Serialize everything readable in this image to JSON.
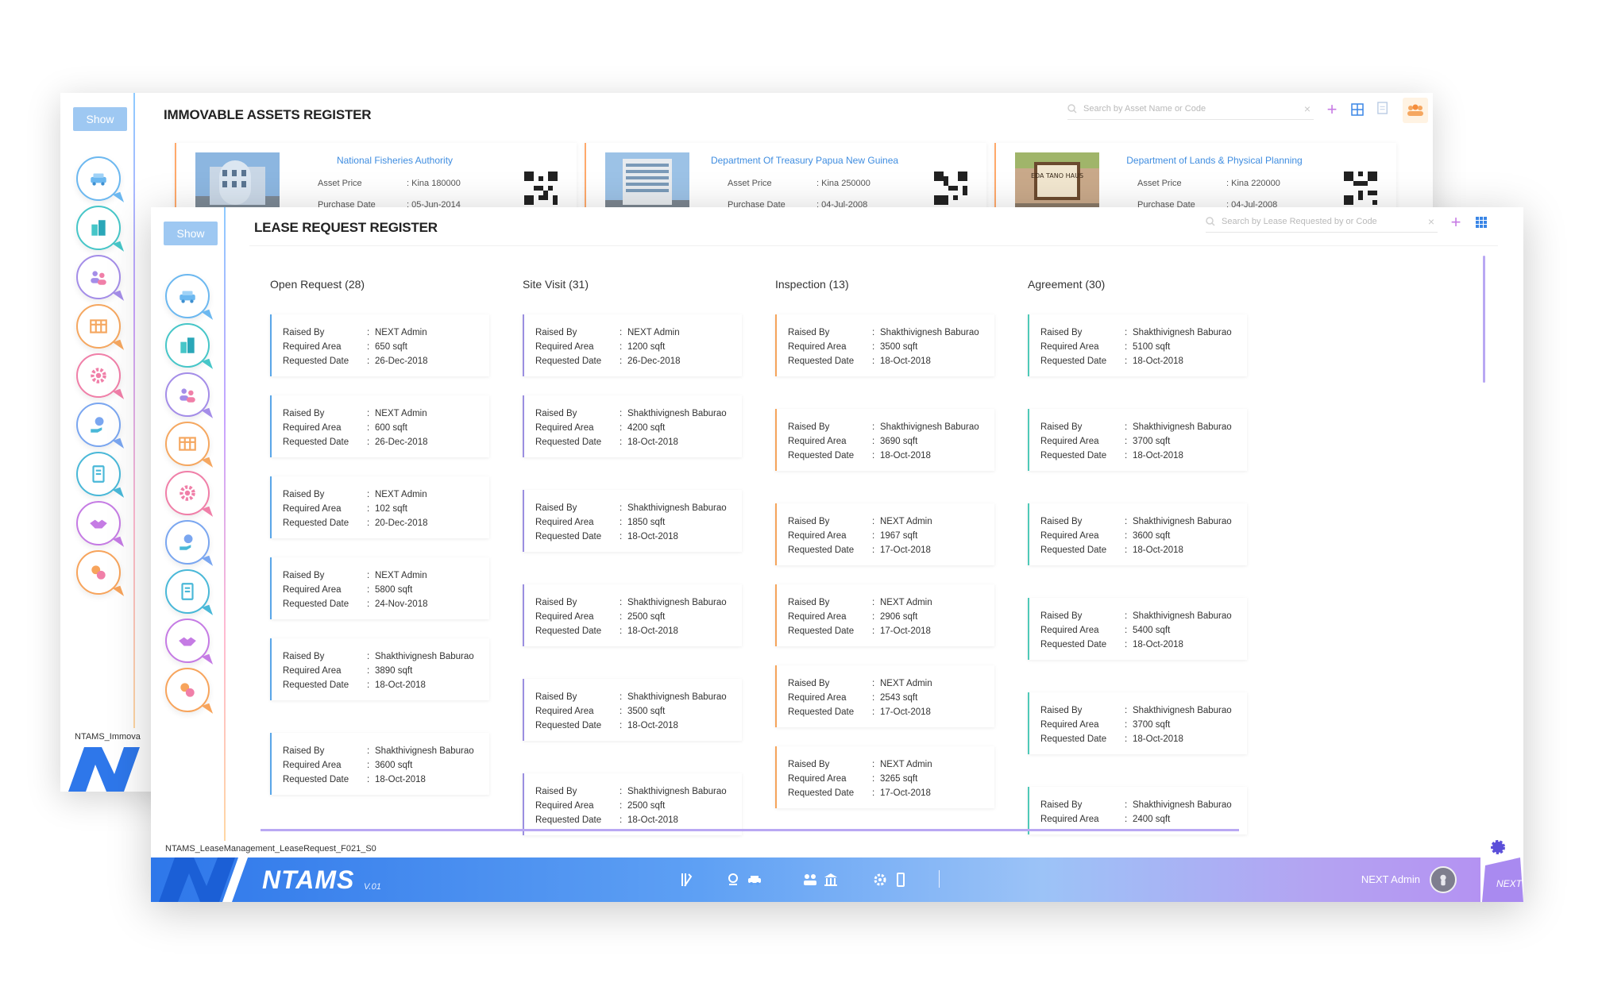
{
  "back_window": {
    "show_label": "Show",
    "title": "IMMOVABLE ASSETS REGISTER",
    "search_placeholder": "Search by Asset Name or Code",
    "footer_code": "NTAMS_Immova",
    "assets": [
      {
        "name": "National Fisheries Authority",
        "price_label": "Asset Price",
        "price": "Kina 180000",
        "date_label": "Purchase Date",
        "date": "05-Jun-2014"
      },
      {
        "name": "Department Of Treasury Papua New Guinea",
        "price_label": "Asset Price",
        "price": "Kina 250000",
        "date_label": "Purchase Date",
        "date": "04-Jul-2008"
      },
      {
        "name": "Department of Lands & Physical Planning",
        "price_label": "Asset Price",
        "price": "Kina 220000",
        "date_label": "Purchase Date",
        "date": "04-Jul-2008",
        "sign_text": "EDA TANO HAUS"
      }
    ]
  },
  "front_window": {
    "show_label": "Show",
    "title": "LEASE REQUEST REGISTER",
    "search_placeholder": "Search by Lease Requested by or Code",
    "footer_code": "NTAMS_LeaseManagement_LeaseRequest_F021_S0",
    "labels": {
      "raised_by": "Raised By",
      "required_area": "Required Area",
      "requested_date": "Requested Date",
      "colon": ":"
    },
    "columns": [
      {
        "title": "Open Request (28)",
        "color": "#5aa6e8",
        "cards": [
          {
            "raised_by": "NEXT Admin",
            "area": "650 sqft",
            "date": "26-Dec-2018"
          },
          {
            "raised_by": "NEXT Admin",
            "area": "600 sqft",
            "date": "26-Dec-2018"
          },
          {
            "raised_by": "NEXT Admin",
            "area": "102 sqft",
            "date": "20-Dec-2018"
          },
          {
            "raised_by": "NEXT Admin",
            "area": "5800 sqft",
            "date": "24-Nov-2018"
          },
          {
            "raised_by": "Shakthivignesh Baburao",
            "area": "3890 sqft",
            "date": "18-Oct-2018"
          },
          {
            "raised_by": "Shakthivignesh Baburao",
            "area": "3600 sqft",
            "date": "18-Oct-2018"
          }
        ]
      },
      {
        "title": "Site Visit (31)",
        "color": "#9b8fe0",
        "cards": [
          {
            "raised_by": "NEXT Admin",
            "area": "1200 sqft",
            "date": "26-Dec-2018"
          },
          {
            "raised_by": "Shakthivignesh Baburao",
            "area": "4200 sqft",
            "date": "18-Oct-2018"
          },
          {
            "raised_by": "Shakthivignesh Baburao",
            "area": "1850 sqft",
            "date": "18-Oct-2018"
          },
          {
            "raised_by": "Shakthivignesh Baburao",
            "area": "2500 sqft",
            "date": "18-Oct-2018"
          },
          {
            "raised_by": "Shakthivignesh Baburao",
            "area": "3500 sqft",
            "date": "18-Oct-2018"
          },
          {
            "raised_by": "Shakthivignesh Baburao",
            "area": "2500 sqft",
            "date": "18-Oct-2018"
          }
        ]
      },
      {
        "title": "Inspection (13)",
        "color": "#f5a45b",
        "cards": [
          {
            "raised_by": "Shakthivignesh Baburao",
            "area": "3500 sqft",
            "date": "18-Oct-2018"
          },
          {
            "raised_by": "Shakthivignesh Baburao",
            "area": "3690 sqft",
            "date": "18-Oct-2018"
          },
          {
            "raised_by": "NEXT Admin",
            "area": "1967 sqft",
            "date": "17-Oct-2018"
          },
          {
            "raised_by": "NEXT Admin",
            "area": "2906 sqft",
            "date": "17-Oct-2018"
          },
          {
            "raised_by": "NEXT Admin",
            "area": "2543 sqft",
            "date": "17-Oct-2018"
          },
          {
            "raised_by": "NEXT Admin",
            "area": "3265 sqft",
            "date": "17-Oct-2018"
          }
        ]
      },
      {
        "title": "Agreement (30)",
        "color": "#4fc9b8",
        "cards": [
          {
            "raised_by": "Shakthivignesh Baburao",
            "area": "5100 sqft",
            "date": "18-Oct-2018"
          },
          {
            "raised_by": "Shakthivignesh Baburao",
            "area": "3700 sqft",
            "date": "18-Oct-2018"
          },
          {
            "raised_by": "Shakthivignesh Baburao",
            "area": "3600 sqft",
            "date": "18-Oct-2018"
          },
          {
            "raised_by": "Shakthivignesh Baburao",
            "area": "5400 sqft",
            "date": "18-Oct-2018"
          },
          {
            "raised_by": "Shakthivignesh Baburao",
            "area": "3700 sqft",
            "date": "18-Oct-2018"
          },
          {
            "raised_by": "Shakthivignesh Baburao",
            "area": "2400 sqft",
            "date": ""
          }
        ]
      }
    ]
  },
  "bottom_bar": {
    "brand": "NTAMS",
    "version": "V.01",
    "user": "NEXT Admin",
    "corner_label": "NEXT"
  },
  "sidebar_icons": [
    {
      "name": "vehicle-icon",
      "color": "#6cb8f0"
    },
    {
      "name": "building-icon",
      "color": "#46c6c8"
    },
    {
      "name": "users-icon",
      "color": "#a48de8"
    },
    {
      "name": "table-icon",
      "color": "#f5a760"
    },
    {
      "name": "gear-icon",
      "color": "#f07fa8"
    },
    {
      "name": "hand-coin-icon",
      "color": "#7aa6f0"
    },
    {
      "name": "document-icon",
      "color": "#49b8d8"
    },
    {
      "name": "handshake-icon",
      "color": "#c57be4"
    },
    {
      "name": "puzzle-icon",
      "color": "#f7a45c"
    }
  ]
}
